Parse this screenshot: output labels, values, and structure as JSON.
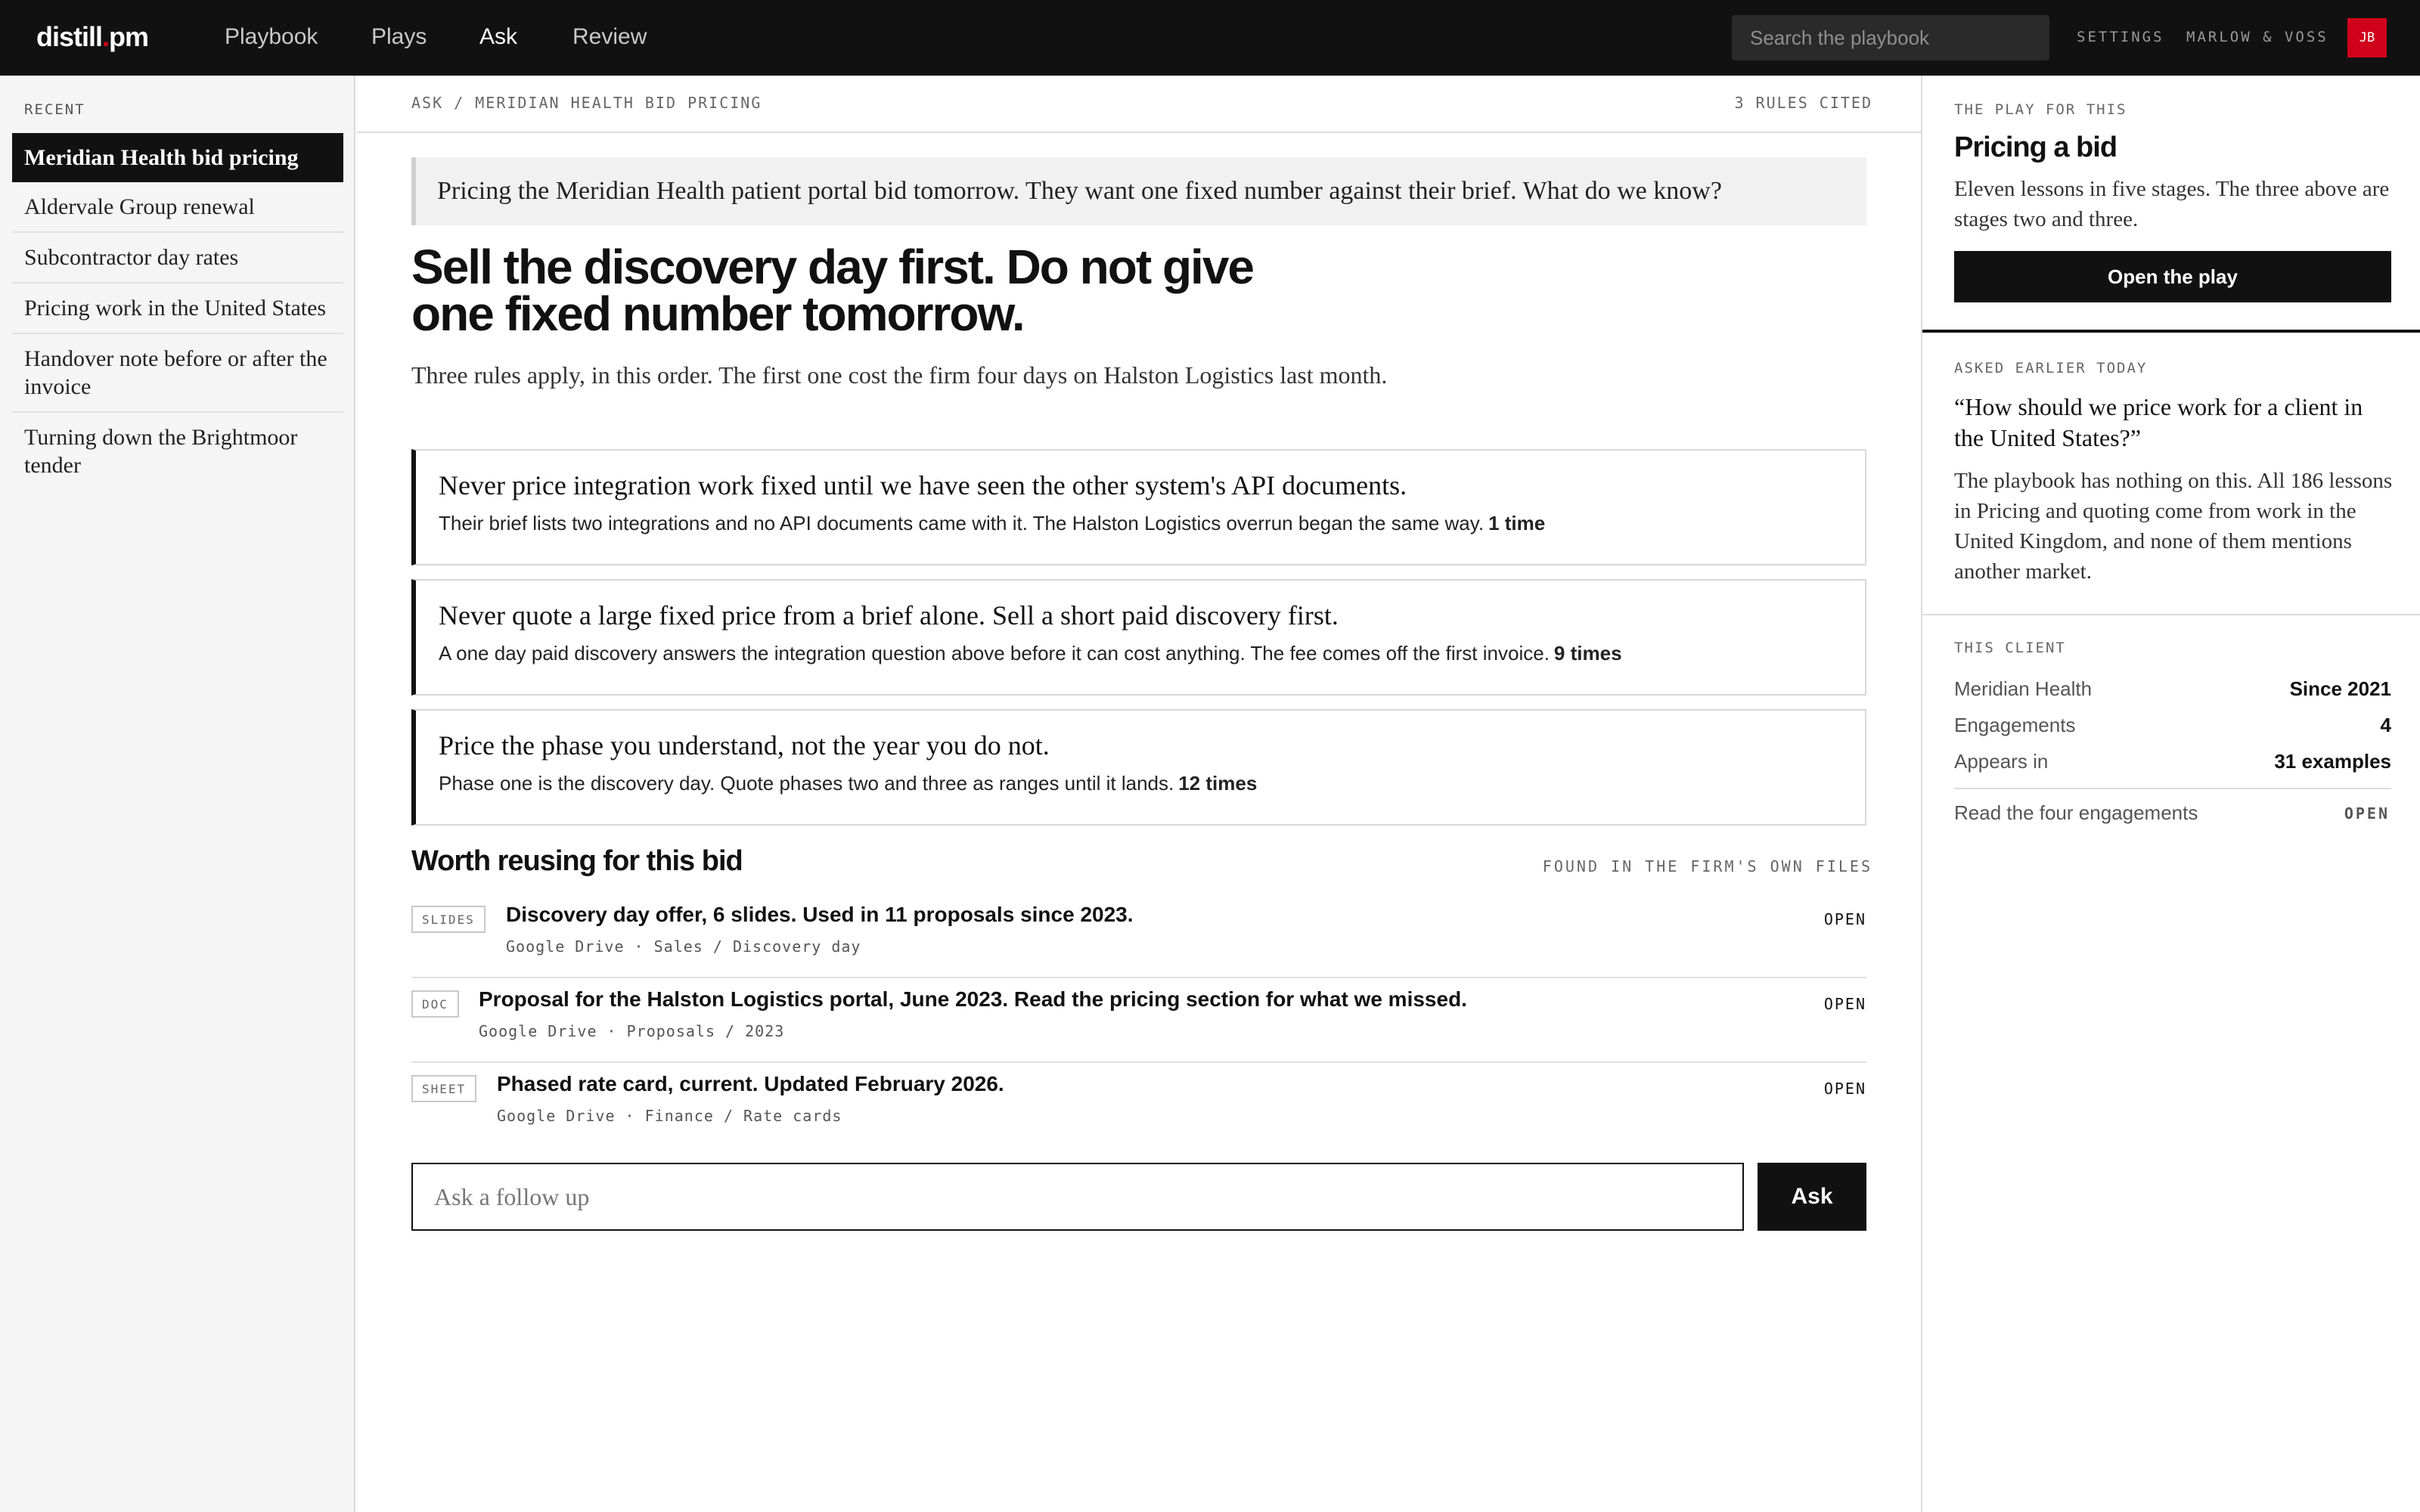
{
  "brand": {
    "name": "distill",
    "dot": ".",
    "suffix": "pm"
  },
  "nav": {
    "playbook": "Playbook",
    "plays": "Plays",
    "ask": "Ask",
    "review": "Review"
  },
  "search": {
    "placeholder": "Search the playbook"
  },
  "topbar": {
    "settings": "SETTINGS",
    "firm": "MARLOW & VOSS",
    "avatar_initials": "JB"
  },
  "sidebar": {
    "label": "RECENT",
    "items": [
      "Meridian Health bid pricing",
      "Aldervale Group renewal",
      "Subcontractor day rates",
      "Pricing work in the United States",
      "Handover note before or after the invoice",
      "Turning down the Brightmoor tender"
    ]
  },
  "main": {
    "breadcrumb": "ASK / MERIDIAN HEALTH BID PRICING",
    "rules_cited": "3 RULES CITED",
    "question": "Pricing the Meridian Health patient portal bid tomorrow. They want one fixed number against their brief. What do we know?",
    "headline": "Sell the discovery day first. Do not give one fixed number tomorrow.",
    "lede": "Three rules apply, in this order. The first one cost the firm four days on Halston Logistics last month.",
    "rules": [
      {
        "title": "Never price integration work fixed until we have seen the other system's API documents.",
        "detail": "Their brief lists two integrations and no API documents came with it. The Halston Logistics overrun began the same way.",
        "count": "1 time"
      },
      {
        "title": "Never quote a large fixed price from a brief alone. Sell a short paid discovery first.",
        "detail": "A one day paid discovery answers the integration question above before it can cost anything. The fee comes off the first invoice.",
        "count": "9 times"
      },
      {
        "title": "Price the phase you understand, not the year you do not.",
        "detail": "Phase one is the discovery day. Quote phases two and three as ranges until it lands.",
        "count": "12 times"
      }
    ],
    "reuse_title": "Worth reusing for this bid",
    "reuse_note": "FOUND IN THE FIRM'S OWN FILES",
    "files": [
      {
        "tag": "SLIDES",
        "title": "Discovery day offer, 6 slides. Used in 11 proposals since 2023.",
        "path": "Google Drive · Sales / Discovery day",
        "action": "OPEN"
      },
      {
        "tag": "DOC",
        "title": "Proposal for the Halston Logistics portal, June 2023. Read the pricing section for what we missed.",
        "path": "Google Drive · Proposals / 2023",
        "action": "OPEN"
      },
      {
        "tag": "SHEET",
        "title": "Phased rate card, current. Updated February 2026.",
        "path": "Google Drive · Finance / Rate cards",
        "action": "OPEN"
      }
    ],
    "followup_placeholder": "Ask a follow up",
    "ask_label": "Ask"
  },
  "right": {
    "play_label": "THE PLAY FOR THIS",
    "play_title": "Pricing a bid",
    "play_desc": "Eleven lessons in five stages. The three above are stages two and three.",
    "open_play": "Open the play",
    "earlier_label": "ASKED EARLIER TODAY",
    "earlier_question": "“How should we price work for a client in the United States?”",
    "earlier_answer": "The playbook has nothing on this. All 186 lessons in Pricing and quoting come from work in the United Kingdom, and none of them mentions another market.",
    "client_label": "THIS CLIENT",
    "client_rows": [
      {
        "key": "Meridian Health",
        "value": "Since 2021"
      },
      {
        "key": "Engagements",
        "value": "4"
      },
      {
        "key": "Appears in",
        "value": "31 examples"
      }
    ],
    "read_engagements": "Read the four engagements",
    "read_open": "OPEN"
  },
  "colors": {
    "topbar": "#111111",
    "accent": "#d0021b",
    "sidebar_bg": "#f5f5f5",
    "text": "#111111"
  }
}
